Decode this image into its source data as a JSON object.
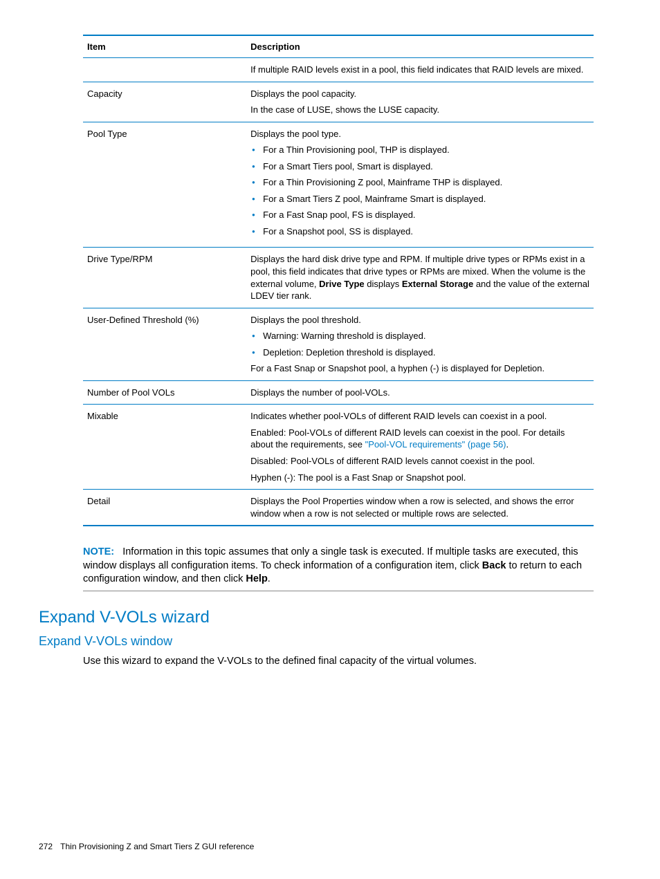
{
  "table": {
    "headers": {
      "item": "Item",
      "description": "Description"
    },
    "rows": {
      "r0": {
        "item": "",
        "desc": "If multiple RAID levels exist in a pool, this field indicates that RAID levels are mixed."
      },
      "r1": {
        "item": "Capacity",
        "p1": "Displays the pool capacity.",
        "p2": "In the case of LUSE, shows the LUSE capacity."
      },
      "r2": {
        "item": "Pool Type",
        "intro": "Displays the pool type.",
        "b1": "For a Thin Provisioning pool, THP is displayed.",
        "b2": "For a Smart Tiers pool, Smart is displayed.",
        "b3": "For a Thin Provisioning Z pool, Mainframe THP is displayed.",
        "b4": "For a Smart Tiers Z pool, Mainframe Smart is displayed.",
        "b5": "For a Fast Snap pool, FS is displayed.",
        "b6": "For a Snapshot pool, SS is displayed."
      },
      "r3": {
        "item": "Drive Type/RPM",
        "pre": "Displays the hard disk drive type and RPM. If multiple drive types or RPMs exist in a pool, this field indicates that drive types or RPMs are mixed. When the volume is the external volume, ",
        "b1": "Drive Type",
        "mid": " displays ",
        "b2": "External Storage",
        "post": " and the value of the external LDEV tier rank."
      },
      "r4": {
        "item": "User-Defined Threshold (%)",
        "intro": "Displays the pool threshold.",
        "b1": "Warning: Warning threshold is displayed.",
        "b2": "Depletion: Depletion threshold is displayed.",
        "post": "For a Fast Snap or Snapshot pool, a hyphen (-) is displayed for Depletion."
      },
      "r5": {
        "item": "Number of Pool VOLs",
        "desc": "Displays the number of pool-VOLs."
      },
      "r6": {
        "item": "Mixable",
        "p1": "Indicates whether pool-VOLs of different RAID levels can coexist in a pool.",
        "p2a": "Enabled: Pool-VOLs of different RAID levels can coexist in the pool. For details about the requirements, see ",
        "p2link": "\"Pool-VOL requirements\" (page 56)",
        "p2b": ".",
        "p3": "Disabled: Pool-VOLs of different RAID levels cannot coexist in the pool.",
        "p4": "Hyphen (-): The pool is a Fast Snap or Snapshot pool."
      },
      "r7": {
        "item": "Detail",
        "desc": "Displays the Pool Properties window when a row is selected, and shows the error window when a row is not selected or multiple rows are selected."
      }
    }
  },
  "note": {
    "label": "NOTE:",
    "t1": "Information in this topic assumes that only a single task is executed. If multiple tasks are executed, this window displays all configuration items. To check information of a configuration item, click ",
    "b1": "Back",
    "t2": " to return to each configuration window, and then click ",
    "b2": "Help",
    "t3": "."
  },
  "headings": {
    "h1": "Expand V-VOLs wizard",
    "h2": "Expand V-VOLs window"
  },
  "body": {
    "p1": "Use this wizard to expand the V-VOLs to the defined final capacity of the virtual volumes."
  },
  "footer": {
    "page": "272",
    "title": "Thin Provisioning Z and Smart Tiers Z GUI reference"
  }
}
